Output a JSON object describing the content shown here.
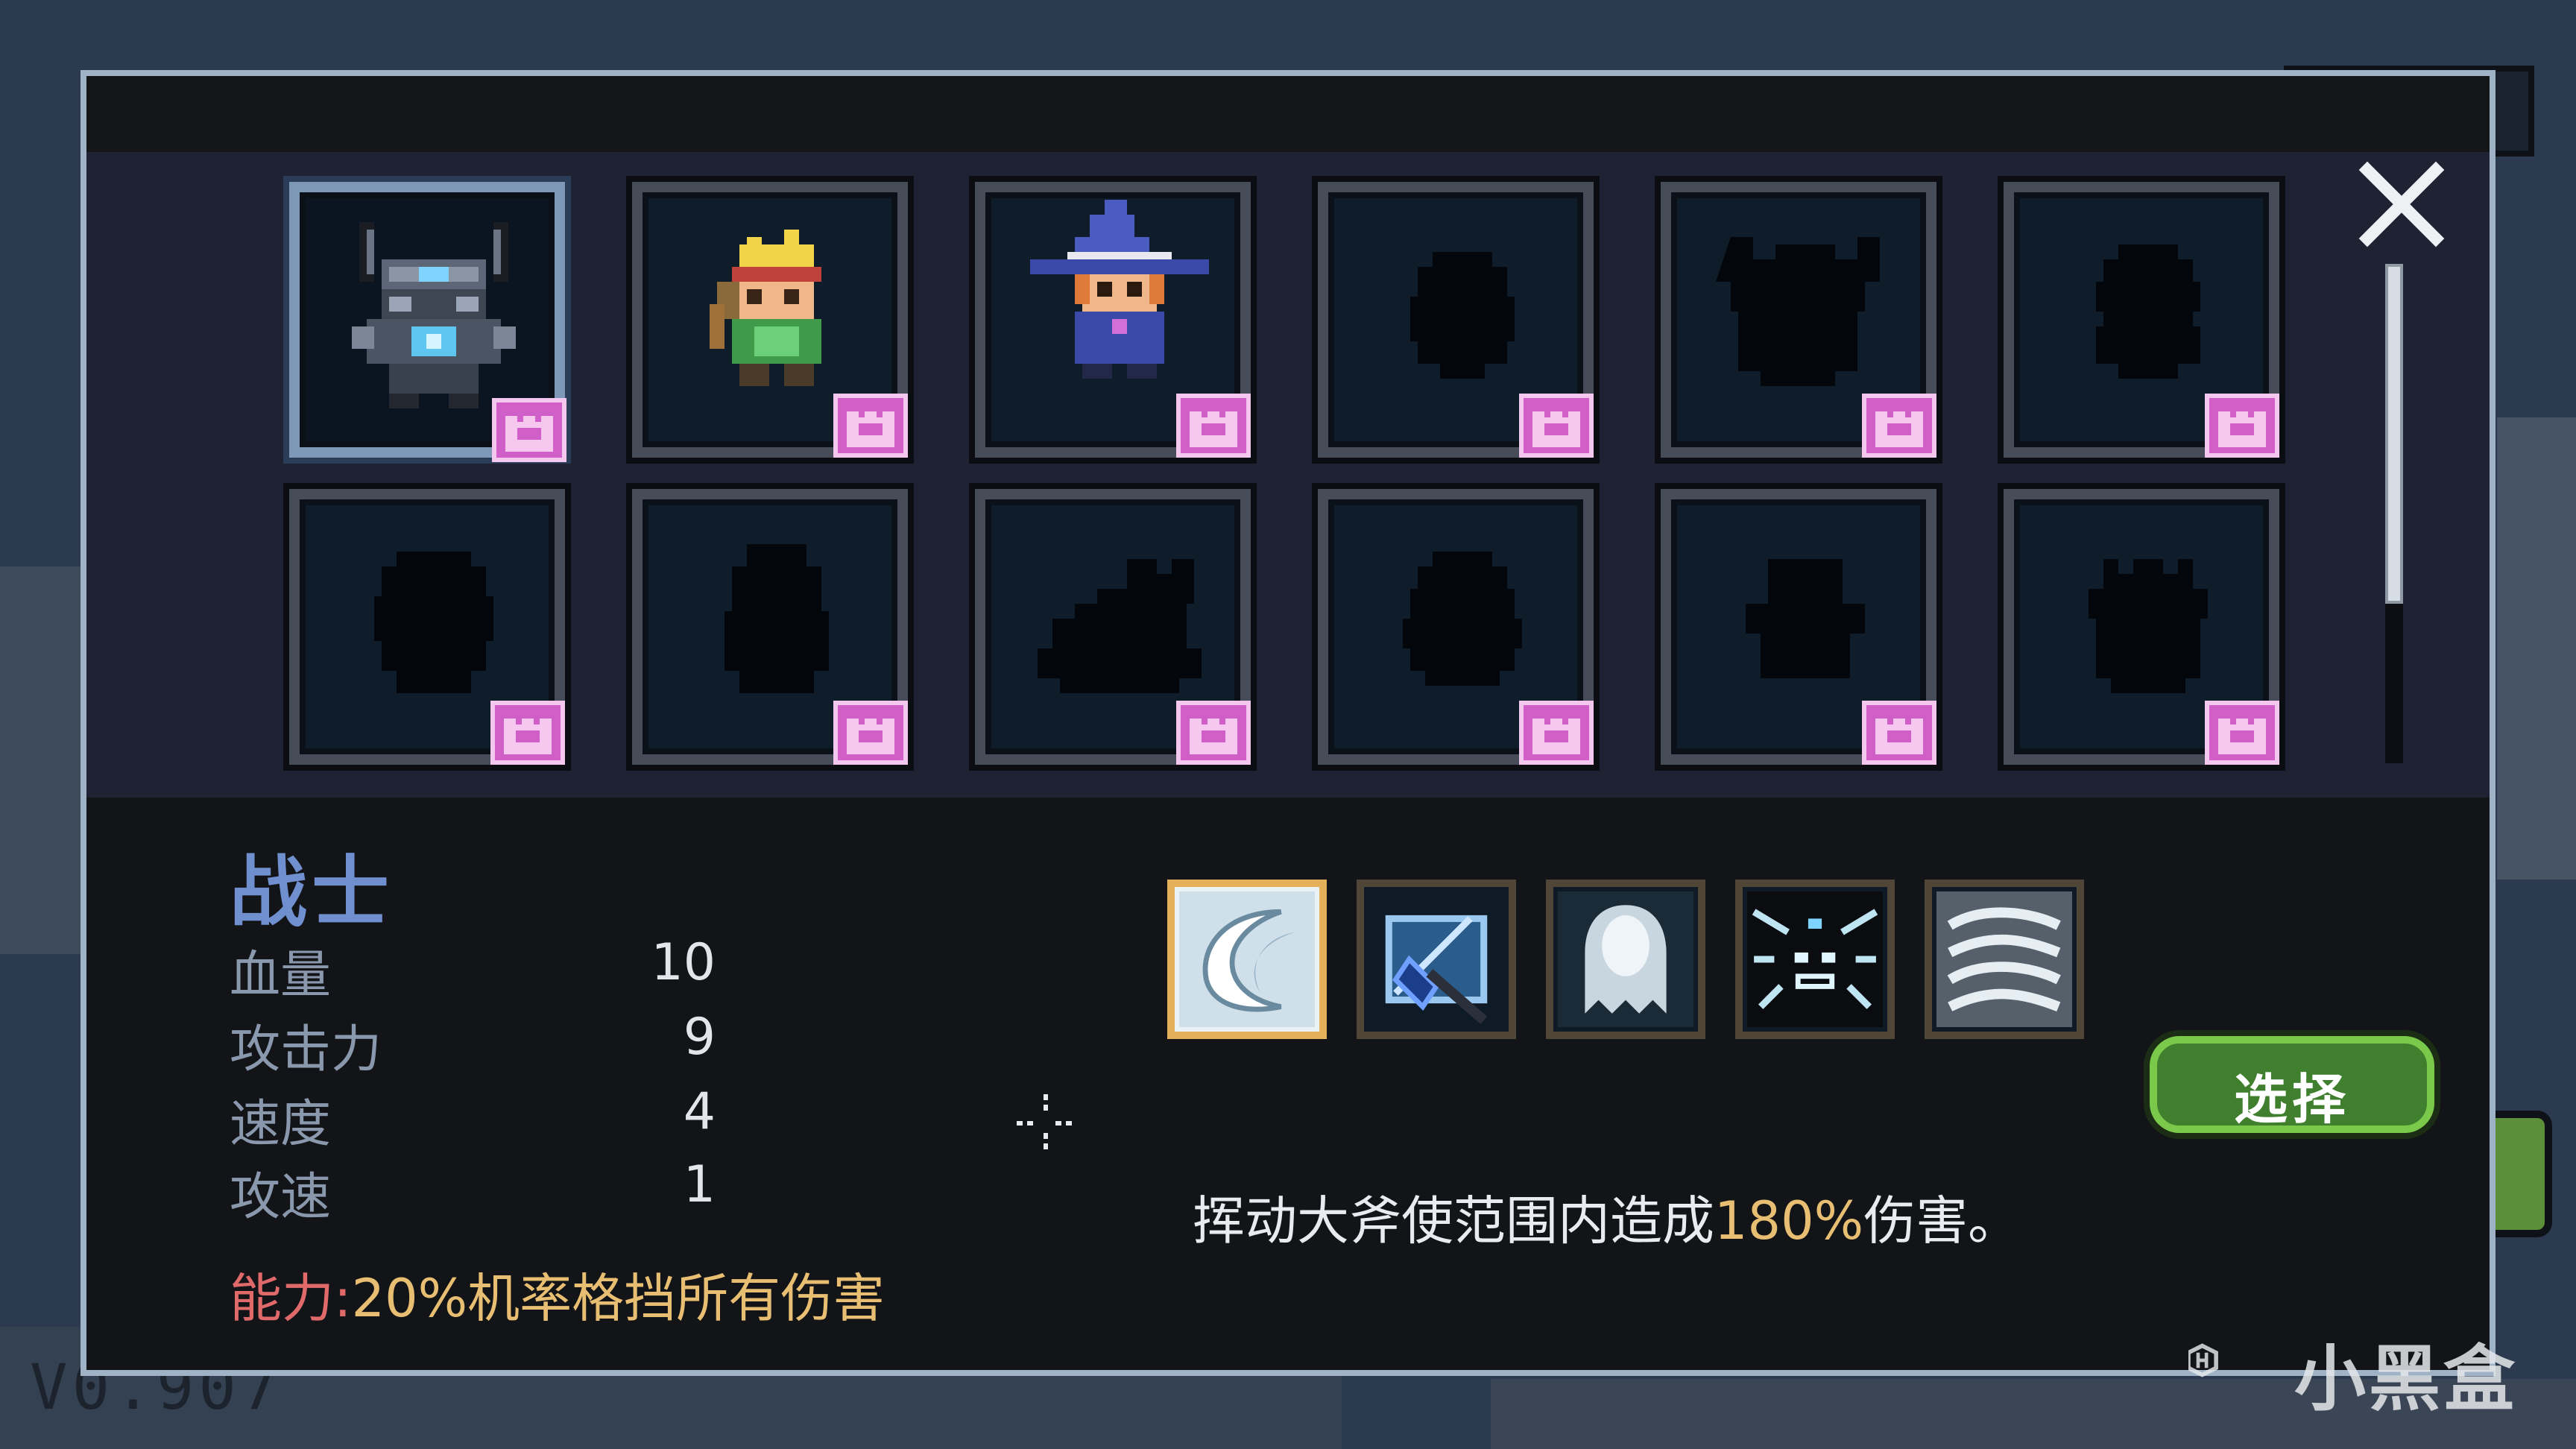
{
  "version": "V0.907",
  "watermark": "小黑盒",
  "close_icon": "close-icon",
  "characters": [
    {
      "id": "warrior",
      "unlocked": true,
      "selected": true
    },
    {
      "id": "ranger",
      "unlocked": true
    },
    {
      "id": "wizard",
      "unlocked": true
    },
    {
      "id": "locked-4",
      "unlocked": false
    },
    {
      "id": "locked-5",
      "unlocked": false
    },
    {
      "id": "locked-6",
      "unlocked": false
    },
    {
      "id": "locked-7",
      "unlocked": false
    },
    {
      "id": "locked-8",
      "unlocked": false
    },
    {
      "id": "locked-9",
      "unlocked": false
    },
    {
      "id": "locked-10",
      "unlocked": false
    },
    {
      "id": "locked-11",
      "unlocked": false
    },
    {
      "id": "locked-12",
      "unlocked": false
    }
  ],
  "selected": {
    "name": "战士",
    "stats": [
      {
        "label": "血量",
        "value": "10"
      },
      {
        "label": "攻击力",
        "value": "9"
      },
      {
        "label": "速度",
        "value": "4"
      },
      {
        "label": "攻速",
        "value": "1"
      }
    ],
    "ability_label": "能力:",
    "ability_text": "20%机率格挡所有伤害"
  },
  "skills": [
    {
      "icon": "crescent-slash-icon",
      "active": true
    },
    {
      "icon": "axe-throw-icon",
      "active": false
    },
    {
      "icon": "ghost-icon",
      "active": false
    },
    {
      "icon": "beast-face-icon",
      "active": false
    },
    {
      "icon": "whirlwind-icon",
      "active": false
    }
  ],
  "skill_description": {
    "before": "挥动大斧使范围内造成",
    "highlight": "180%",
    "after": "伤害。"
  },
  "select_button": "选择",
  "colors": {
    "name_blue": "#6f8fcf",
    "ability_red": "#e06a6a",
    "highlight_gold": "#e8be72",
    "badge_pink": "#d060c8",
    "button_green": "#3f7f2d"
  }
}
